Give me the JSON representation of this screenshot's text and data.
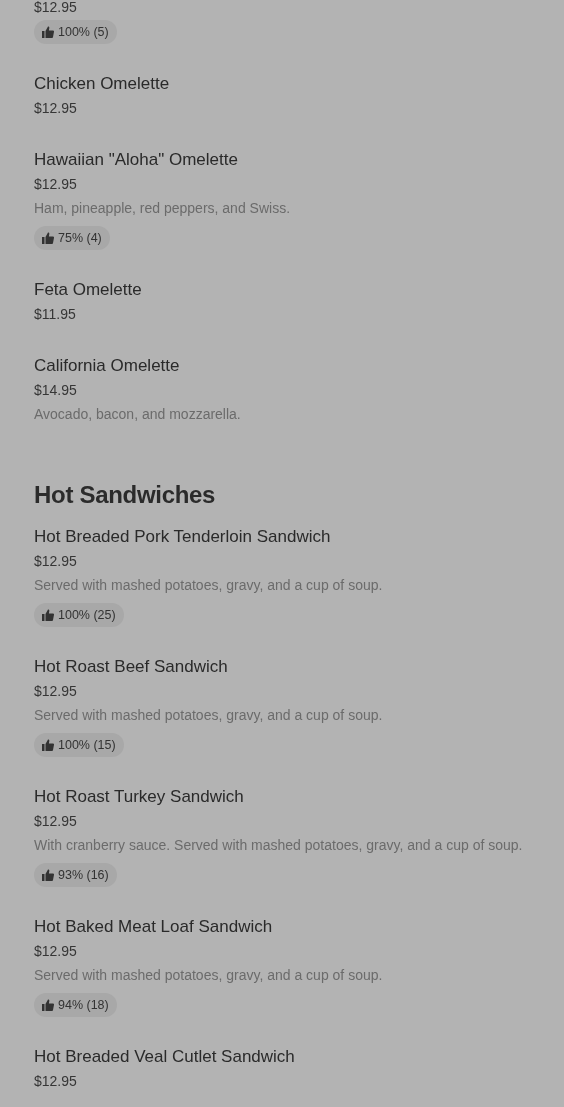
{
  "sections": [
    {
      "items": [
        {
          "price": "$12.95",
          "rating": "100% (5)"
        },
        {
          "name": "Chicken Omelette",
          "price": "$12.95"
        },
        {
          "name": "Hawaiian \"Aloha\" Omelette",
          "price": "$12.95",
          "description": "Ham, pineapple, red peppers, and Swiss.",
          "rating": "75% (4)"
        },
        {
          "name": "Feta Omelette",
          "price": "$11.95"
        },
        {
          "name": "California Omelette",
          "price": "$14.95",
          "description": "Avocado, bacon, and mozzarella."
        }
      ]
    },
    {
      "title": "Hot Sandwiches",
      "items": [
        {
          "name": "Hot Breaded Pork Tenderloin Sandwich",
          "price": "$12.95",
          "description": "Served with mashed potatoes, gravy, and a cup of soup.",
          "rating": "100% (25)"
        },
        {
          "name": "Hot Roast Beef Sandwich",
          "price": "$12.95",
          "description": "Served with mashed potatoes, gravy, and a cup of soup.",
          "rating": "100% (15)"
        },
        {
          "name": "Hot Roast Turkey Sandwich",
          "price": "$12.95",
          "description": "With cranberry sauce. Served with mashed potatoes, gravy, and a cup of soup.",
          "rating": "93% (16)"
        },
        {
          "name": "Hot Baked Meat Loaf Sandwich",
          "price": "$12.95",
          "description": "Served with mashed potatoes, gravy, and a cup of soup.",
          "rating": "94% (18)"
        },
        {
          "name": "Hot Breaded Veal Cutlet Sandwich",
          "price": "$12.95"
        }
      ]
    }
  ]
}
